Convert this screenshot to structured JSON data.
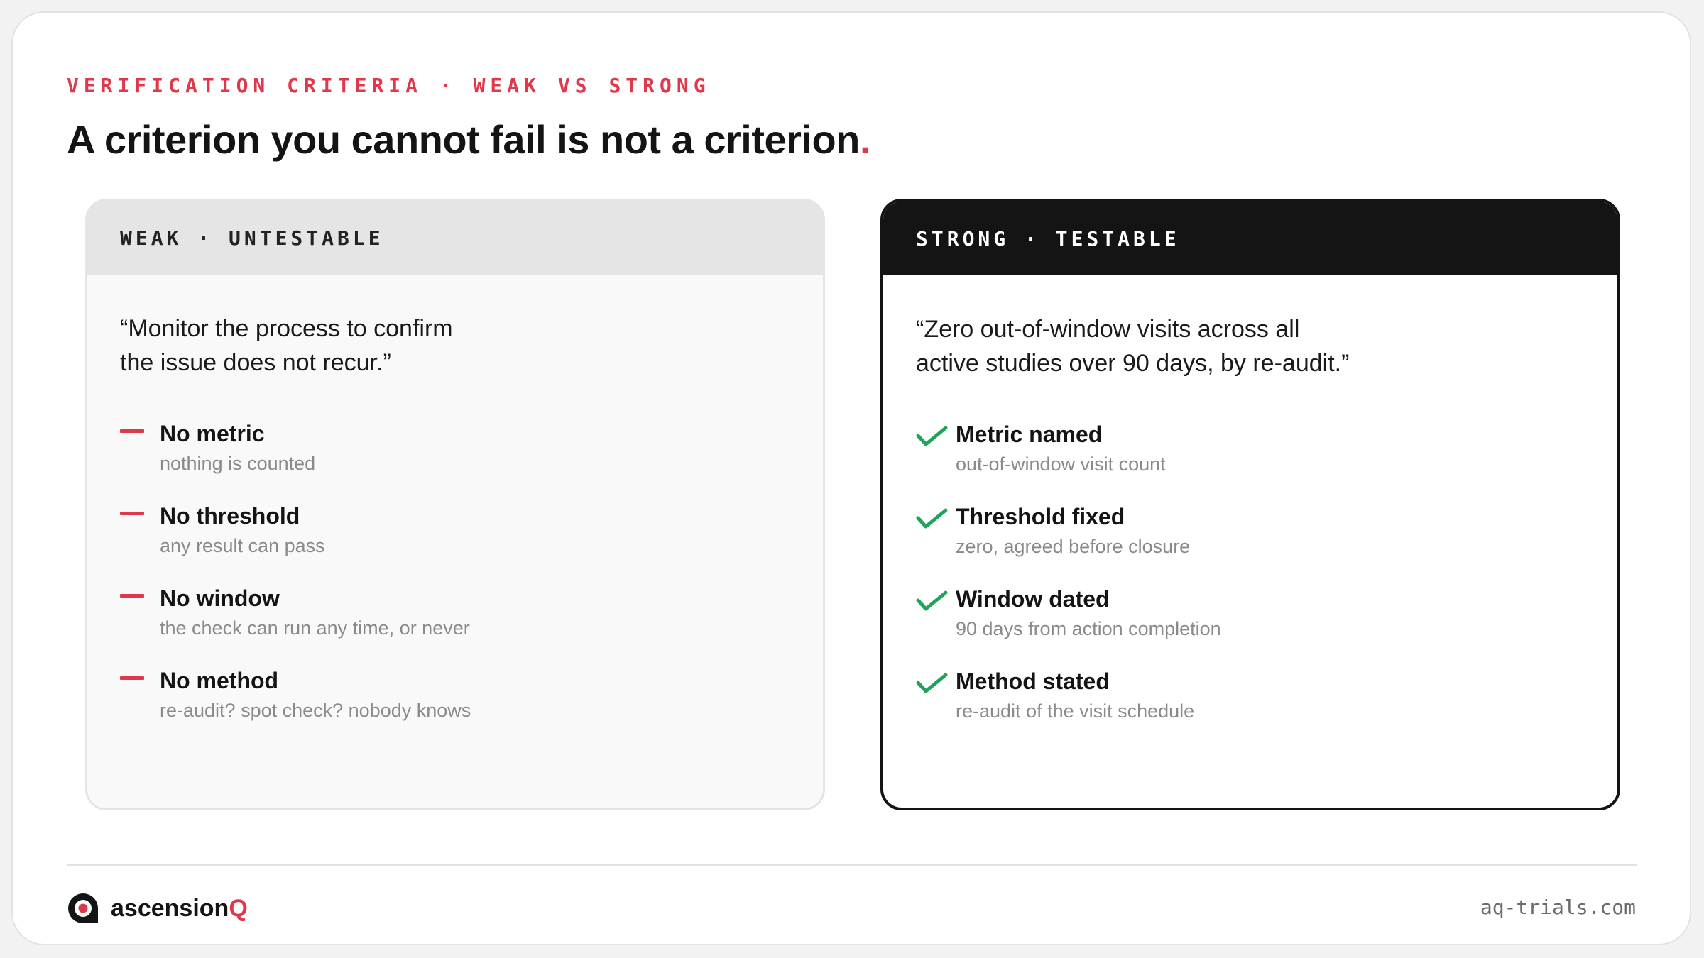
{
  "header": {
    "eyebrow": "VERIFICATION CRITERIA · WEAK VS STRONG",
    "headline": "A criterion you cannot fail is not a criterion",
    "headline_punct": "."
  },
  "colors": {
    "accent": "#e0384b",
    "check": "#1fa45a",
    "ink": "#141414",
    "muted": "#8a8a8a"
  },
  "weak": {
    "label": "WEAK · UNTESTABLE",
    "quote_line1": "“Monitor the process to confirm",
    "quote_line2": "the issue does not recur.”",
    "marker_icon": "dash-icon",
    "items": [
      {
        "title": "No metric",
        "sub": "nothing is counted"
      },
      {
        "title": "No threshold",
        "sub": "any result can pass"
      },
      {
        "title": "No window",
        "sub": "the check can run any time, or never"
      },
      {
        "title": "No method",
        "sub": "re-audit? spot check? nobody knows"
      }
    ]
  },
  "strong": {
    "label": "STRONG · TESTABLE",
    "quote_line1": "“Zero out-of-window visits across all",
    "quote_line2": "active studies over 90 days, by re-audit.”",
    "marker_icon": "check-icon",
    "items": [
      {
        "title": "Metric named",
        "sub": "out-of-window visit count"
      },
      {
        "title": "Threshold fixed",
        "sub": "zero, agreed before closure"
      },
      {
        "title": "Window dated",
        "sub": "90 days from action completion"
      },
      {
        "title": "Method stated",
        "sub": "re-audit of the visit schedule"
      }
    ]
  },
  "footer": {
    "brand_name": "ascension",
    "brand_accent": "Q",
    "brand_icon": "ascensionq-logo-icon",
    "site": "aq-trials.com"
  }
}
